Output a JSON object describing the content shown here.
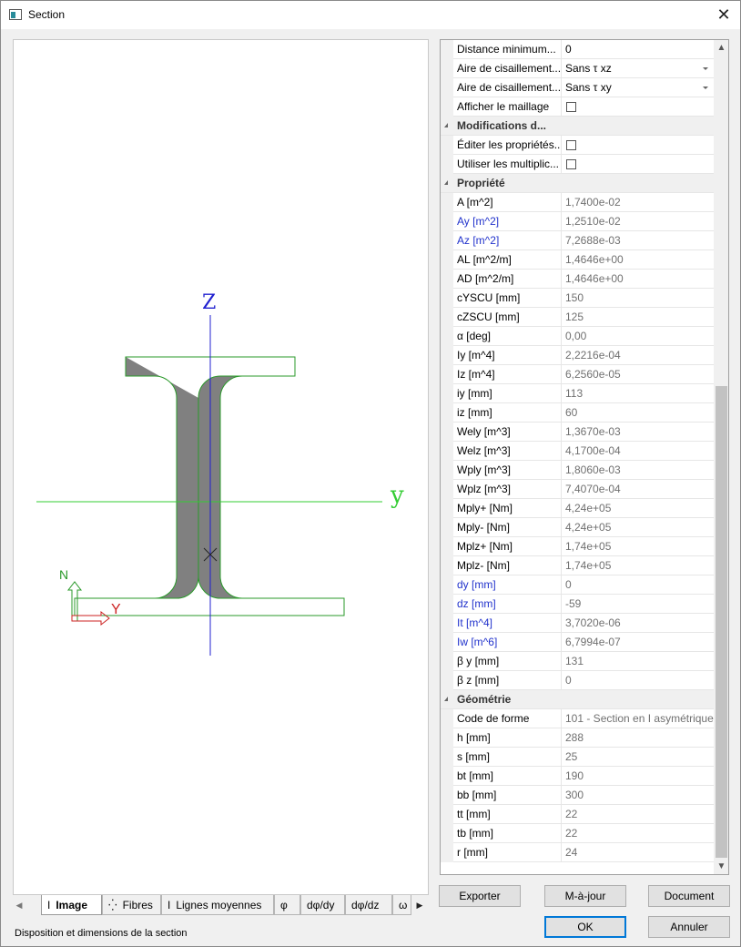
{
  "window": {
    "title": "Section",
    "close_glyph": "✕"
  },
  "canvas": {
    "axis_z_label": "Z",
    "axis_y_label": "y",
    "local_n_label": "N",
    "local_y_label": "Y",
    "colors": {
      "section_fill": "#808080",
      "section_outline": "#2a9a2a",
      "z_axis": "#2020d0",
      "y_axis": "#33cc33",
      "local_axis": "#cc2222"
    }
  },
  "tabs": [
    {
      "label": "Image",
      "icon": "i-beam-icon",
      "glyph": "I"
    },
    {
      "label": "Fibres",
      "icon": "fibres-icon",
      "glyph": "⁛"
    },
    {
      "label": "Lignes moyennes",
      "icon": "i-beam-outline-icon",
      "glyph": "I"
    },
    {
      "label": "φ"
    },
    {
      "label": "dφ/dy"
    },
    {
      "label": "dφ/dz"
    },
    {
      "label": "ω"
    }
  ],
  "status": "Disposition et dimensions de la section",
  "properties": {
    "options": [
      {
        "name": "Distance minimum...",
        "value": "0",
        "kind": "text"
      },
      {
        "name": "Aire de cisaillement...",
        "value": "Sans τ xz",
        "kind": "dropdown"
      },
      {
        "name": "Aire de cisaillement...",
        "value": "Sans τ xy",
        "kind": "dropdown"
      },
      {
        "name": "Afficher le maillage",
        "kind": "checkbox"
      }
    ],
    "cat_modifications": "Modifications d...",
    "modifications": [
      {
        "name": "Éditer les propriétés...",
        "kind": "checkbox"
      },
      {
        "name": "Utiliser les multiplic...",
        "kind": "checkbox"
      }
    ],
    "cat_propriete": "Propriété",
    "propriete": [
      {
        "name": "A [m^2]",
        "value": "1,7400e-02"
      },
      {
        "name": "Ay [m^2]",
        "value": "1,2510e-02",
        "blue": true
      },
      {
        "name": "Az [m^2]",
        "value": "7,2688e-03",
        "blue": true
      },
      {
        "name": "AL [m^2/m]",
        "value": "1,4646e+00"
      },
      {
        "name": "AD [m^2/m]",
        "value": "1,4646e+00"
      },
      {
        "name": "cYSCU [mm]",
        "value": "150"
      },
      {
        "name": "cZSCU [mm]",
        "value": "125"
      },
      {
        "name": "α [deg]",
        "value": "0,00"
      },
      {
        "name": "Iy [m^4]",
        "value": "2,2216e-04"
      },
      {
        "name": "Iz [m^4]",
        "value": "6,2560e-05"
      },
      {
        "name": "iy [mm]",
        "value": "113"
      },
      {
        "name": "iz [mm]",
        "value": "60"
      },
      {
        "name": "Wely [m^3]",
        "value": "1,3670e-03"
      },
      {
        "name": "Welz [m^3]",
        "value": "4,1700e-04"
      },
      {
        "name": "Wply [m^3]",
        "value": "1,8060e-03"
      },
      {
        "name": "Wplz [m^3]",
        "value": "7,4070e-04"
      },
      {
        "name": "Mply+ [Nm]",
        "value": "4,24e+05"
      },
      {
        "name": "Mply- [Nm]",
        "value": "4,24e+05"
      },
      {
        "name": "Mplz+ [Nm]",
        "value": "1,74e+05"
      },
      {
        "name": "Mplz- [Nm]",
        "value": "1,74e+05"
      },
      {
        "name": "dy [mm]",
        "value": "0",
        "blue": true
      },
      {
        "name": "dz [mm]",
        "value": "-59",
        "blue": true
      },
      {
        "name": "It [m^4]",
        "value": "3,7020e-06",
        "blue": true
      },
      {
        "name": "Iw [m^6]",
        "value": "6,7994e-07",
        "blue": true
      },
      {
        "name": "β y [mm]",
        "value": "131"
      },
      {
        "name": "β z [mm]",
        "value": "0"
      }
    ],
    "cat_geometrie": "Géométrie",
    "geometrie": [
      {
        "name": "Code de forme",
        "value": "101 - Section en I asymétrique"
      },
      {
        "name": "h [mm]",
        "value": "288"
      },
      {
        "name": "s [mm]",
        "value": "25"
      },
      {
        "name": "bt [mm]",
        "value": "190"
      },
      {
        "name": "bb [mm]",
        "value": "300"
      },
      {
        "name": "tt [mm]",
        "value": "22"
      },
      {
        "name": "tb [mm]",
        "value": "22"
      },
      {
        "name": "r [mm]",
        "value": "24"
      }
    ]
  },
  "buttons": {
    "exporter": "Exporter",
    "update": "M-à-jour",
    "document": "Document",
    "ok": "OK",
    "annuler": "Annuler"
  }
}
